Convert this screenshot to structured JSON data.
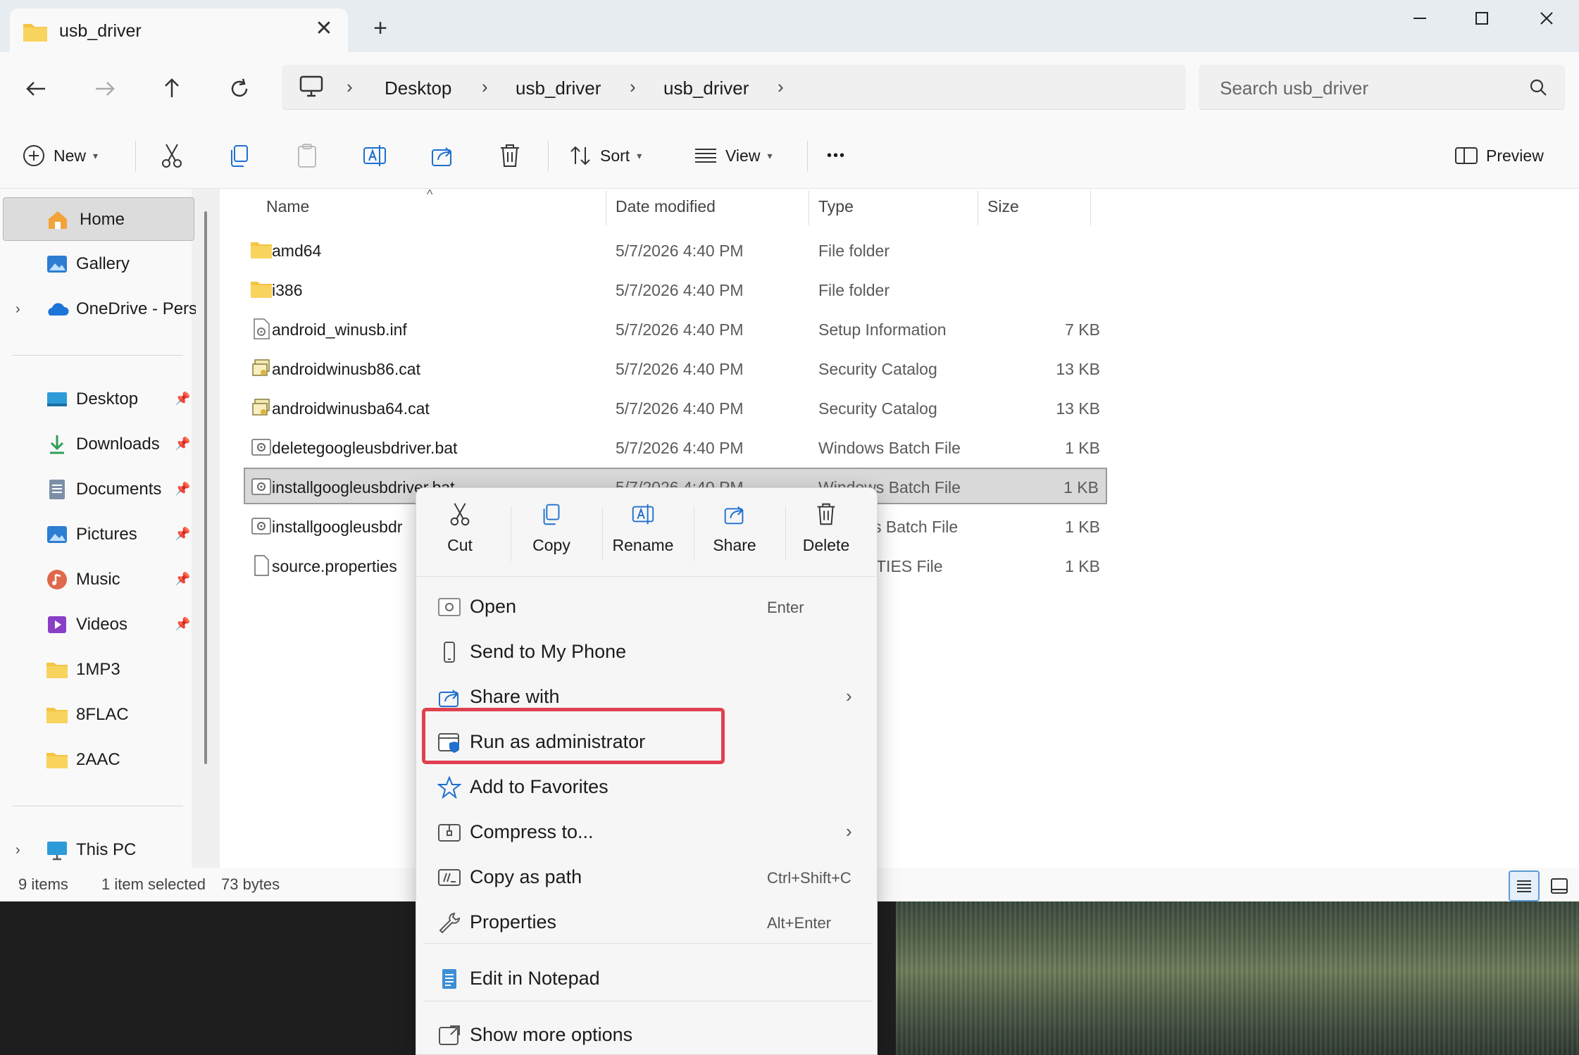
{
  "window": {
    "tab_title": "usb_driver",
    "new_tab": "+",
    "close_tab": "✕"
  },
  "navigation": {
    "breadcrumbs": [
      "Desktop",
      "usb_driver",
      "usb_driver"
    ],
    "search_placeholder": "Search usb_driver"
  },
  "toolbar": {
    "new_label": "New",
    "sort_label": "Sort",
    "view_label": "View",
    "more_label": "•••",
    "preview_label": "Preview"
  },
  "sidebar": {
    "items": [
      {
        "label": "Home",
        "icon": "home-icon"
      },
      {
        "label": "Gallery",
        "icon": "gallery-icon"
      },
      {
        "label": "OneDrive - Persi",
        "icon": "onedrive-icon"
      },
      {
        "label": "Desktop",
        "icon": "desktop-icon",
        "pinned": true
      },
      {
        "label": "Downloads",
        "icon": "downloads-icon",
        "pinned": true
      },
      {
        "label": "Documents",
        "icon": "documents-icon",
        "pinned": true
      },
      {
        "label": "Pictures",
        "icon": "pictures-icon",
        "pinned": true
      },
      {
        "label": "Music",
        "icon": "music-icon",
        "pinned": true
      },
      {
        "label": "Videos",
        "icon": "videos-icon",
        "pinned": true
      },
      {
        "label": "1MP3",
        "icon": "folder-icon"
      },
      {
        "label": "8FLAC",
        "icon": "folder-icon"
      },
      {
        "label": "2AAC",
        "icon": "folder-icon"
      },
      {
        "label": "This PC",
        "icon": "this-pc-icon"
      }
    ]
  },
  "columns": {
    "name": "Name",
    "date": "Date modified",
    "type": "Type",
    "size": "Size"
  },
  "files": [
    {
      "name": "amd64",
      "date": "5/7/2026 4:40 PM",
      "type": "File folder",
      "size": "",
      "icon": "folder-icon"
    },
    {
      "name": "i386",
      "date": "5/7/2026 4:40 PM",
      "type": "File folder",
      "size": "",
      "icon": "folder-icon"
    },
    {
      "name": "android_winusb.inf",
      "date": "5/7/2026 4:40 PM",
      "type": "Setup Information",
      "size": "7 KB",
      "icon": "setup-file-icon"
    },
    {
      "name": "androidwinusb86.cat",
      "date": "5/7/2026 4:40 PM",
      "type": "Security Catalog",
      "size": "13 KB",
      "icon": "catalog-file-icon"
    },
    {
      "name": "androidwinusba64.cat",
      "date": "5/7/2026 4:40 PM",
      "type": "Security Catalog",
      "size": "13 KB",
      "icon": "catalog-file-icon"
    },
    {
      "name": "deletegoogleusbdriver.bat",
      "date": "5/7/2026 4:40 PM",
      "type": "Windows Batch File",
      "size": "1 KB",
      "icon": "batch-file-icon"
    },
    {
      "name": "installgoogleusbdriver.bat",
      "date": "5/7/2026 4:40 PM",
      "type": "Windows Batch File",
      "size": "1 KB",
      "icon": "batch-file-icon",
      "selected": true
    },
    {
      "name": "installgoogleusbdr",
      "date": "",
      "type": "s Batch File",
      "size": "1 KB",
      "icon": "batch-file-icon"
    },
    {
      "name": "source.properties",
      "date": "",
      "type": "TIES File",
      "size": "1 KB",
      "icon": "blank-file-icon"
    }
  ],
  "status": {
    "item_count": "9 items",
    "selection": "1 item selected",
    "selection_size": "73 bytes"
  },
  "context_menu": {
    "quick_actions": [
      "Cut",
      "Copy",
      "Rename",
      "Share",
      "Delete"
    ],
    "items": [
      {
        "label": "Open",
        "shortcut": "Enter"
      },
      {
        "label": "Send to My Phone",
        "shortcut": ""
      },
      {
        "label": "Share with",
        "shortcut": "",
        "submenu": true
      },
      {
        "label": "Run as administrator",
        "shortcut": "",
        "highlighted": true
      },
      {
        "label": "Add to Favorites",
        "shortcut": ""
      },
      {
        "label": "Compress to...",
        "shortcut": "",
        "submenu": true
      },
      {
        "label": "Copy as path",
        "shortcut": "Ctrl+Shift+C"
      },
      {
        "label": "Properties",
        "shortcut": "Alt+Enter"
      },
      {
        "label": "Edit in Notepad",
        "shortcut": ""
      },
      {
        "label": "Show more options",
        "shortcut": ""
      }
    ],
    "highlight_color": "#e0404f"
  },
  "colors": {
    "folder": "#f4c542",
    "accent": "#0067c0",
    "selection": "#d9d9d9"
  }
}
